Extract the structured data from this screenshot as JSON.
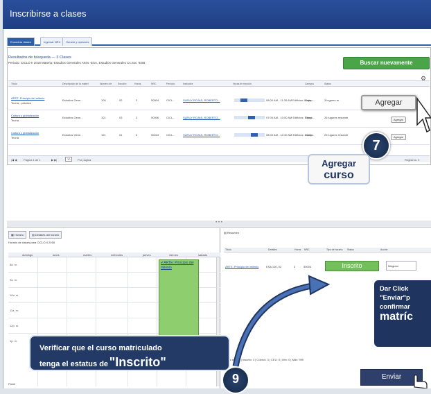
{
  "window": {
    "title": "Inscribirse a clases"
  },
  "tabs": [
    {
      "label": "Encontrar clases",
      "active": true
    },
    {
      "label": "Ingresar NRC",
      "active": false
    },
    {
      "label": "Horario y opciones",
      "active": false
    }
  ],
  "results": {
    "title": "Resultados de búsqueda — 3 Clases",
    "subtitle": "Periodo: CICLO II 2018    Materia: Estudios Generales Artes -ESA, Estudios Generales Cs.Soc -ESB",
    "search_again_label": "Buscar nuevamente",
    "columns": [
      "Título",
      "Descripción de la materi",
      "Número de",
      "Sección",
      "Horas",
      "NRC",
      "Período",
      "Instructor",
      "Horas de reunión",
      "Campus",
      "Status"
    ],
    "rows": [
      {
        "title": "ARTE: Principio del milenio",
        "subtitle": "Teoría - práctica",
        "description": "Estudios Gene...",
        "number": "100",
        "section": "02",
        "hours": "3",
        "nrc": "50004",
        "period": "CICL...",
        "instructor": "SURUY ROJAS, ROBERTO...",
        "meeting": "08:00 AM - 11:30 AM Edificios: Mnýo",
        "campus": "Camp...",
        "status": "3 lugares re",
        "action": "Agregar"
      },
      {
        "title": "Cultura y globalización",
        "subtitle": "Teoría",
        "description": "Estudios Gene...",
        "number": "101",
        "section": "03",
        "hours": "3",
        "nrc": "50006",
        "period": "CICL...",
        "instructor": "SURUY ROJAS, ROBERTO...",
        "meeting": "07:00 AM - 10:00 AM Edificios: Filosó",
        "campus": "Camp...",
        "status": "26 lugares restante",
        "action": "Agregar"
      },
      {
        "title": "Cultura y globalización",
        "subtitle": "Teoría",
        "description": "Estudios Gene...",
        "number": "101",
        "section": "01",
        "hours": "3",
        "nrc": "50013",
        "period": "CICL...",
        "instructor": "SURUY ROJAS, ROBERTO...",
        "meeting": "08:00 AM - 10:30 AM Edificios: Centro",
        "campus": "Camp...",
        "status": "29 lugares restante",
        "action": "Agregar"
      }
    ],
    "pager": "Página 1 de 1",
    "per_page": "10",
    "per_page_suffix": "Por página",
    "records": "Registros: 3"
  },
  "agregar_big": "Agregar",
  "callout_7": {
    "number": "7",
    "line1": "Agregar",
    "line2": "curso"
  },
  "schedule": {
    "tab_horario": "Horario",
    "tab_detalles": "Detalles del horario",
    "title": "Horario de clases para CICLO II 2018",
    "days": [
      "domingo",
      "lunes",
      "martes",
      "miércoles",
      "jueves",
      "viernes",
      "sabado"
    ],
    "hours": [
      "8a. m.",
      "9a. m.",
      "10a. m.",
      "11a. m.",
      "12p. m.",
      "1p. m."
    ],
    "course_block": "ARTE: Principio del milenio",
    "footer": "Panel"
  },
  "summary": {
    "title": "Resumen",
    "columns": [
      "Título",
      "Detalles",
      "Horas",
      "NRC",
      "Tipo de horario",
      "Status",
      "Acción"
    ],
    "row": {
      "title": "ARTE: Principio del milenio",
      "details": "ESA 100, 02",
      "hours": "3",
      "nrc": "50004",
      "type": "Clase",
      "status": "Inscrito",
      "action": "Ninguno"
    },
    "totals": "Horas totales | Inscrito: 3 | Cobros: 3 | CEU: 0 | Mín: 0 | Máx: 999",
    "submit_label": "Enviar"
  },
  "callout_right": {
    "line1": "Dar Click",
    "line2": "\"Enviar\"p",
    "line3": "confirmar",
    "line4": "matríc"
  },
  "callout_left": {
    "line1": "Verificar que el curso matriculado",
    "line2": "tenga el estatus de",
    "line2_big": "\"Inscrito\""
  },
  "callout_9": {
    "number": "9"
  }
}
